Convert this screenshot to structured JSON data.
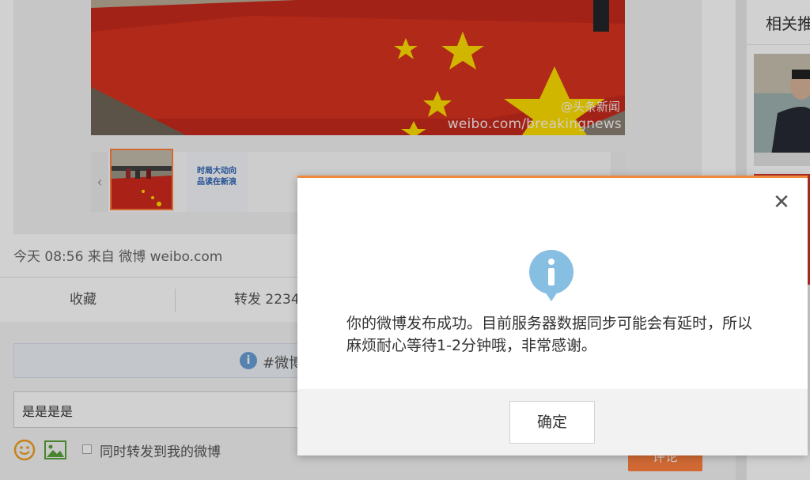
{
  "post": {
    "watermark_top": "@头条新闻",
    "watermark": "weibo.com/breakingnews",
    "thumb2_text": "时局大动向\n品读在新浪",
    "meta": "今天 08:56 来自 微博 weibo.com",
    "actions": {
      "favorite": "收藏",
      "forward": "转发 2234"
    }
  },
  "comment": {
    "topic_text": "#微博",
    "input_value": "是是是是",
    "forward_label": "同时转发到我的微博",
    "submit_label": "评论"
  },
  "sidebar": {
    "title": "相关推"
  },
  "dialog": {
    "message": "你的微博发布成功。目前服务器数据同步可能会有延时，所以麻烦耐心等待1-2分钟哦，非常感谢。",
    "ok_label": "确定",
    "close_glyph": "✕"
  },
  "colors": {
    "accent": "#ff8140",
    "dialog_top_border": "#f08a3e",
    "info_icon": "#7fb6de",
    "flag_red": "#d52a1e",
    "flag_star": "#ffde00"
  }
}
